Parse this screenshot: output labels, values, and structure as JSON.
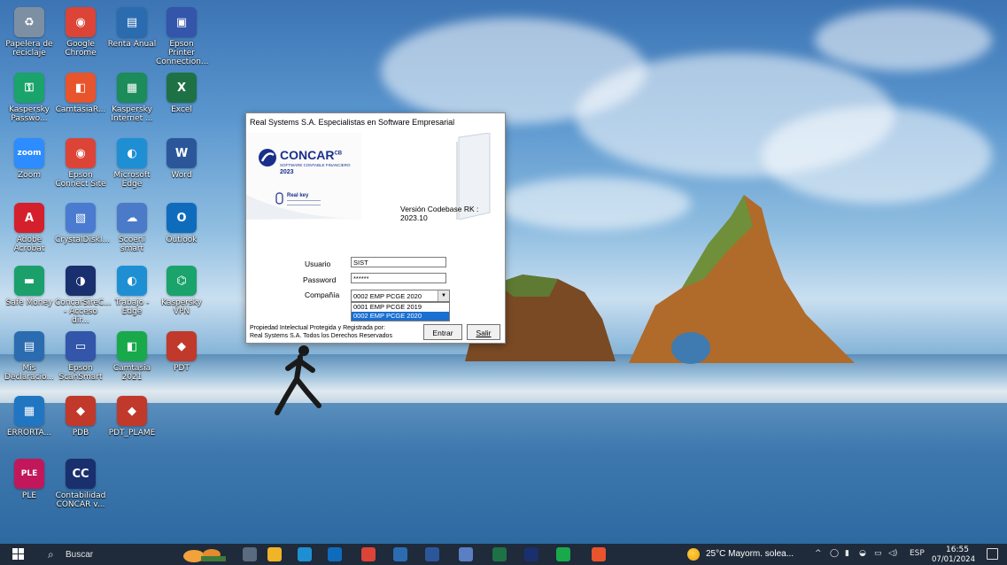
{
  "desktop": {
    "icons": [
      {
        "label": "Papelera de reciclaje",
        "icon": "recycle-bin-icon",
        "color": "#7d8fa3",
        "glyph": "♻"
      },
      {
        "label": "Google Chrome",
        "icon": "chrome-icon",
        "color": "#db4437",
        "glyph": "◉"
      },
      {
        "label": "Renta Anual",
        "icon": "renta-anual-icon",
        "color": "#2b6cb0",
        "glyph": "▤"
      },
      {
        "label": "Epson Printer Connection...",
        "icon": "epson-printer-icon",
        "color": "#3355aa",
        "glyph": "▣"
      },
      {
        "label": "Kaspersky Passwo...",
        "icon": "kaspersky-password-icon",
        "color": "#1aa36a",
        "glyph": "⚿"
      },
      {
        "label": "CamtasiaR...",
        "icon": "camtasia-recorder-icon",
        "color": "#e8542c",
        "glyph": "◧"
      },
      {
        "label": "Kaspersky Internet ...",
        "icon": "kaspersky-internet-icon",
        "color": "#1b8c5a",
        "glyph": "▦"
      },
      {
        "label": "Excel",
        "icon": "excel-icon",
        "color": "#1e7145",
        "glyph": "X"
      },
      {
        "label": "Zoom",
        "icon": "zoom-icon",
        "color": "#2d8cff",
        "glyph": "zoom"
      },
      {
        "label": "Epson Connect Site",
        "icon": "epson-connect-icon",
        "color": "#db4437",
        "glyph": "◉"
      },
      {
        "label": "Microsoft Edge",
        "icon": "edge-icon",
        "color": "#1f8fd4",
        "glyph": "◐"
      },
      {
        "label": "Word",
        "icon": "word-icon",
        "color": "#2b579a",
        "glyph": "W"
      },
      {
        "label": "Adobe Acrobat",
        "icon": "acrobat-icon",
        "color": "#d4202c",
        "glyph": "A"
      },
      {
        "label": "CrystalDiskI...",
        "icon": "crystaldisk-icon",
        "color": "#4a7bd0",
        "glyph": "▧"
      },
      {
        "label": "Scoeni smart",
        "icon": "scoeni-smart-icon",
        "color": "#4a7ac8",
        "glyph": "☁"
      },
      {
        "label": "Outlook",
        "icon": "outlook-icon",
        "color": "#0f6cbd",
        "glyph": "O"
      },
      {
        "label": "Safe Money",
        "icon": "safe-money-icon",
        "color": "#1ba06b",
        "glyph": "▬"
      },
      {
        "label": "ConcarSireC... - Acceso dir...",
        "icon": "concar-shortcut-icon",
        "color": "#1a2f6e",
        "glyph": "◑"
      },
      {
        "label": "Trabajo - Edge",
        "icon": "edge-work-icon",
        "color": "#1f8fd4",
        "glyph": "◐"
      },
      {
        "label": "Kaspersky VPN",
        "icon": "kaspersky-vpn-icon",
        "color": "#1aa36a",
        "glyph": "⌬"
      },
      {
        "label": "Mis Declaracio...",
        "icon": "mis-declaraciones-icon",
        "color": "#2b6cb0",
        "glyph": "▤"
      },
      {
        "label": "Epson ScanSmart",
        "icon": "epson-scansmart-icon",
        "color": "#3355aa",
        "glyph": "▭"
      },
      {
        "label": "Camtasia 2021",
        "icon": "camtasia-icon",
        "color": "#18a94b",
        "glyph": "◧"
      },
      {
        "label": "PDT",
        "icon": "pdt-icon",
        "color": "#c0392b",
        "glyph": "◆"
      },
      {
        "label": "ERRORTA...",
        "icon": "errorta-icon",
        "color": "#2176c2",
        "glyph": "▦"
      },
      {
        "label": "PDB",
        "icon": "pdb-icon",
        "color": "#c0392b",
        "glyph": "◆"
      },
      {
        "label": "PDT_PLAME",
        "icon": "pdt-plame-icon",
        "color": "#c0392b",
        "glyph": "◆"
      },
      {
        "label": "PLE",
        "icon": "ple-icon",
        "color": "#c2185b",
        "glyph": "PLE"
      },
      {
        "label": "Contabilidad CONCAR v...",
        "icon": "concar-contabilidad-icon",
        "color": "#1a2f6e",
        "glyph": "CC"
      }
    ]
  },
  "dialog": {
    "title": "Real Systems S.A. Especialistas en Software Empresarial",
    "logo": "CONCAR",
    "logo_suffix": "CB",
    "logo_subtitle": "SOFTWARE CONTABLE FINANCIERO",
    "logo_year": "2023",
    "realkey": "Real key",
    "version": "Versión Codebase RK : 2023.10",
    "user_label": "Usuario",
    "user_value": "SIST",
    "password_label": "Password",
    "password_value": "******",
    "company_label": "Compañía",
    "company_selected": "0002 EMP PCGE 2020",
    "company_options": [
      "0001 EMP PCGE 2019",
      "0002 EMP PCGE 2020"
    ],
    "footer_line1": "Propiedad Intelectual Protegida y Registrada por:",
    "footer_line2": "Real Systems S.A. Todos los Derechos Reservados",
    "enter_button": "Entrar",
    "exit_button": "Salir",
    "accent_color": "#1a2f8c"
  },
  "taskbar": {
    "search_placeholder": "Buscar",
    "weather": "25°C  Mayorm. solea...",
    "language": "ESP",
    "time": "16:55",
    "date": "07/01/2024",
    "pinned": [
      {
        "icon": "task-view-icon",
        "color": "#5a6b80"
      },
      {
        "icon": "file-explorer-icon",
        "color": "#f0b429"
      },
      {
        "icon": "edge-icon",
        "color": "#1f8fd4"
      },
      {
        "icon": "outlook-icon",
        "color": "#0f6cbd"
      },
      {
        "icon": "chrome-icon",
        "color": "#db4437"
      },
      {
        "icon": "store-icon",
        "color": "#2b6cb0"
      },
      {
        "icon": "word-icon",
        "color": "#2b579a"
      },
      {
        "icon": "renta-icon",
        "color": "#5b7fc4"
      },
      {
        "icon": "excel-icon",
        "color": "#1e7145"
      },
      {
        "icon": "concar-icon",
        "color": "#1a2f6e"
      },
      {
        "icon": "camtasia-icon",
        "color": "#18a94b"
      },
      {
        "icon": "camtasia-recorder-icon",
        "color": "#e8542c"
      }
    ]
  }
}
